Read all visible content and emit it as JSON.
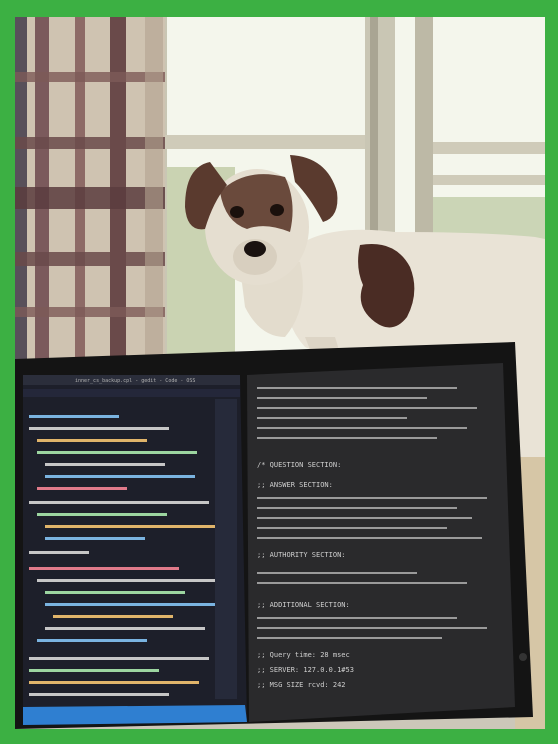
{
  "frame": {
    "border_color": "#3cb043"
  },
  "photo": {
    "subject": "dog-standing-on-windowsill",
    "colors": {
      "wall": "#d9dccf",
      "window_glow": "#f4f6ec",
      "window_frame": "#c9c6b4",
      "curtain_light": "#cfc3b1",
      "curtain_dark": "#6a4a4a",
      "dog_white": "#e9e3d6",
      "dog_brown": "#4a2c24",
      "monitor_bezel": "#141414",
      "editor_bg": "#1d1f2a",
      "terminal_bg": "#2a2a2c",
      "editor_statusbar": "#2f7fd1"
    }
  },
  "monitor": {
    "editor_title": "inner_cs_backup.cpl - gedit - Code - OSS",
    "terminal_lines": [
      "/* QUESTION SECTION:",
      ";; ANSWER SECTION:",
      ";; AUTHORITY SECTION:",
      ";; ADDITIONAL SECTION:",
      ";; Query time: 28 msec",
      ";; SERVER: 127.0.0.1#53",
      ";; MSG SIZE  rcvd: 242"
    ]
  }
}
